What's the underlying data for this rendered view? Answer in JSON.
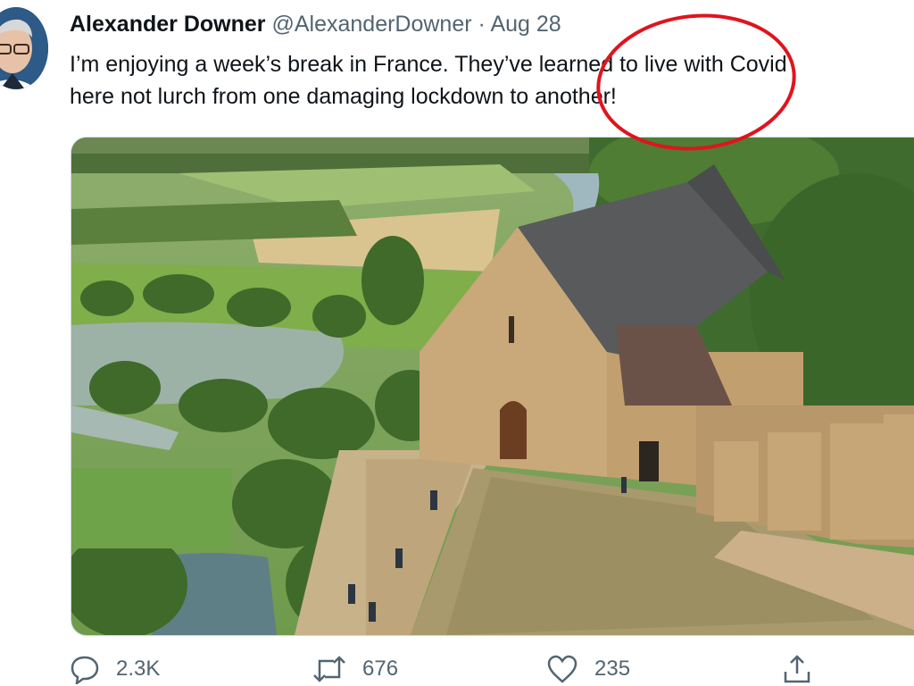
{
  "tweet": {
    "author_name": "Alexander Downer",
    "author_handle": "@AlexanderDowner",
    "separator": "·",
    "date": "Aug 28",
    "text_line1": "I’m enjoying a week’s break in France. They’ve learned to live with Covid",
    "text_line2": "here not lurch from one damaging lockdown to another!"
  },
  "media": {
    "alt": "Aerial view of a stone chapel on castle ramparts above a green river valley"
  },
  "annotation": {
    "color": "#e0141e"
  },
  "actions": {
    "replies": "2.3K",
    "retweets": "676",
    "likes": "235"
  },
  "icons": [
    "reply-icon",
    "retweet-icon",
    "like-icon",
    "share-icon"
  ]
}
